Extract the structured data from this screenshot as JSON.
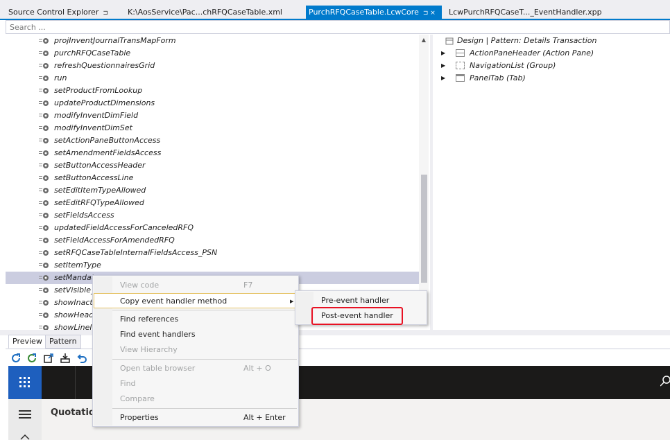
{
  "tabs": [
    {
      "label": "Source Control Explorer",
      "pin": "⊐"
    },
    {
      "label": "K:\\AosService\\Pac...chRFQCaseTable.xml"
    },
    {
      "label": "PurchRFQCaseTable.LcwCore",
      "pin": "⊐ ×"
    },
    {
      "label": "LcwPurchRFQCaseT..._EventHandler.xpp"
    }
  ],
  "search": {
    "placeholder": "Search ..."
  },
  "tree": {
    "items": [
      "projInventJournalTransMapForm",
      "purchRFQCaseTable",
      "refreshQuestionnairesGrid",
      "run",
      "setProductFromLookup",
      "updateProductDimensions",
      "modifyInventDimField",
      "modifyInventDimSet",
      "setActionPaneButtonAccess",
      "setAmendmentFieldsAccess",
      "setButtonAccessHeader",
      "setButtonAccessLine",
      "setEditItemTypeAllowed",
      "setEditRFQTypeAllowed",
      "setFieldsAccess",
      "updatedFieldAccessForCanceledRFQ",
      "setFieldAccessForAmendedRFQ",
      "setRFQCaseTableInternalFieldsAccess_PSN",
      "setItemType",
      "setMandat",
      "setVisible_",
      "showInacti",
      "showHead",
      "showLineI"
    ]
  },
  "design": {
    "root": "Design | Pattern: Details Transaction",
    "children": [
      {
        "label": "ActionPaneHeader (Action Pane)",
        "icon": "action-pane-icon"
      },
      {
        "label": "NavigationList (Group)",
        "icon": "group-icon"
      },
      {
        "label": "PanelTab (Tab)",
        "icon": "tab-icon"
      }
    ]
  },
  "bottom_tabs": [
    "Preview",
    "Pattern"
  ],
  "preview": {
    "title": "Quotation"
  },
  "context_menu": {
    "items": [
      {
        "label": "View code",
        "shortcut": "F7",
        "disabled": true
      },
      {
        "label": "Copy event handler method",
        "submenu": true
      },
      {
        "label": "Find references"
      },
      {
        "label": "Find event handlers"
      },
      {
        "label": "View Hierarchy",
        "disabled": true
      },
      {
        "label": "Open table browser",
        "shortcut": "Alt + O",
        "disabled": true
      },
      {
        "label": "Find",
        "disabled": true
      },
      {
        "label": "Compare",
        "disabled": true
      },
      {
        "label": "Properties",
        "shortcut": "Alt + Enter"
      }
    ]
  },
  "submenu": {
    "items": [
      {
        "label": "Pre-event handler"
      },
      {
        "label": "Post-event handler"
      }
    ]
  },
  "colors": {
    "accent": "#007acc",
    "selection": "#cbcde0",
    "highlight": "#e81123",
    "waffle": "#1e5fbe"
  }
}
